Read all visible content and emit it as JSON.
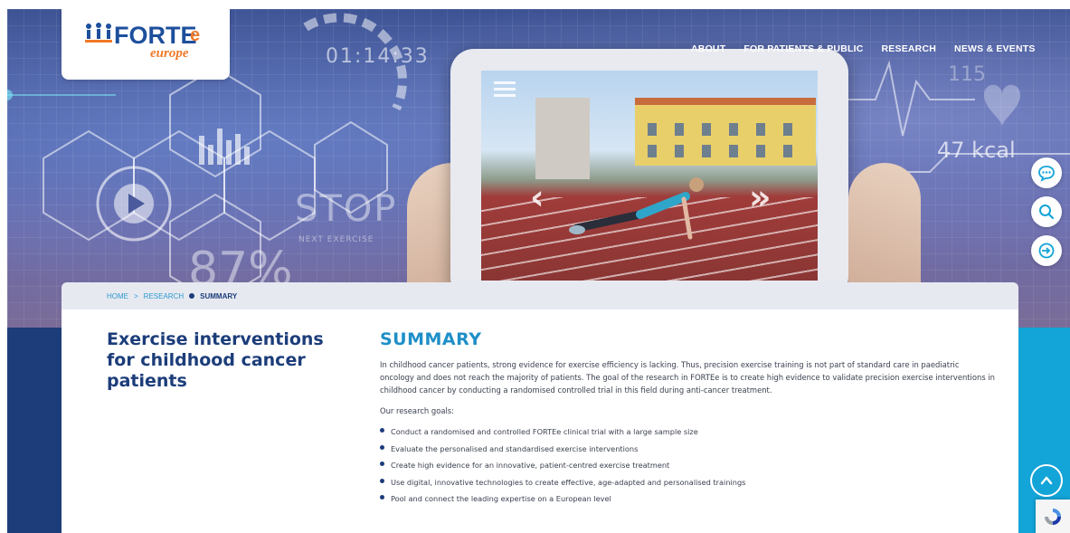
{
  "logo": {
    "brand": "FORTE",
    "suffix": "e",
    "sub": "europe"
  },
  "nav": {
    "items": [
      "ABOUT",
      "FOR PATIENTS & PUBLIC",
      "RESEARCH",
      "NEWS & EVENTS"
    ]
  },
  "hero": {
    "timer": "01:14:33",
    "stop": "STOP",
    "next_exercise": "NEXT EXERCISE",
    "percent": "87%",
    "kcal": "47 kcal",
    "heart_rate": "115"
  },
  "breadcrumb": {
    "home": "HOME",
    "sep": ">",
    "research": "RESEARCH",
    "current": "SUMMARY"
  },
  "page": {
    "side_title": "Exercise interventions for childhood cancer patients",
    "summary_heading": "SUMMARY",
    "paragraph": "In childhood cancer patients, strong evidence for exercise efficiency is lacking. Thus, precision exercise training is not part of standard care in paediatric oncology and does not reach the majority of patients. The goal of the research in FORTEe is to create high evidence to validate precision exercise interventions in childhood cancer by conducting a randomised controlled trial in this field during anti-cancer treatment.",
    "goals_intro": "Our research goals:",
    "goals": [
      "Conduct a randomised and controlled FORTEe clinical trial with a large sample size",
      "Evaluate the personalised and standardised exercise interventions",
      "Create high evidence for an innovative, patient-centred exercise treatment",
      "Use digital, innovative technologies to create effective, age-adapted and personalised trainings",
      "Pool and connect the leading expertise on a European level"
    ]
  },
  "colors": {
    "navy": "#1c3d7a",
    "cyan": "#13a4d8",
    "heading_blue": "#1e8fc8",
    "orange": "#f07a28"
  },
  "icons": [
    "chat-icon",
    "search-icon",
    "login-icon",
    "chevron-up-icon",
    "recaptcha-icon"
  ]
}
